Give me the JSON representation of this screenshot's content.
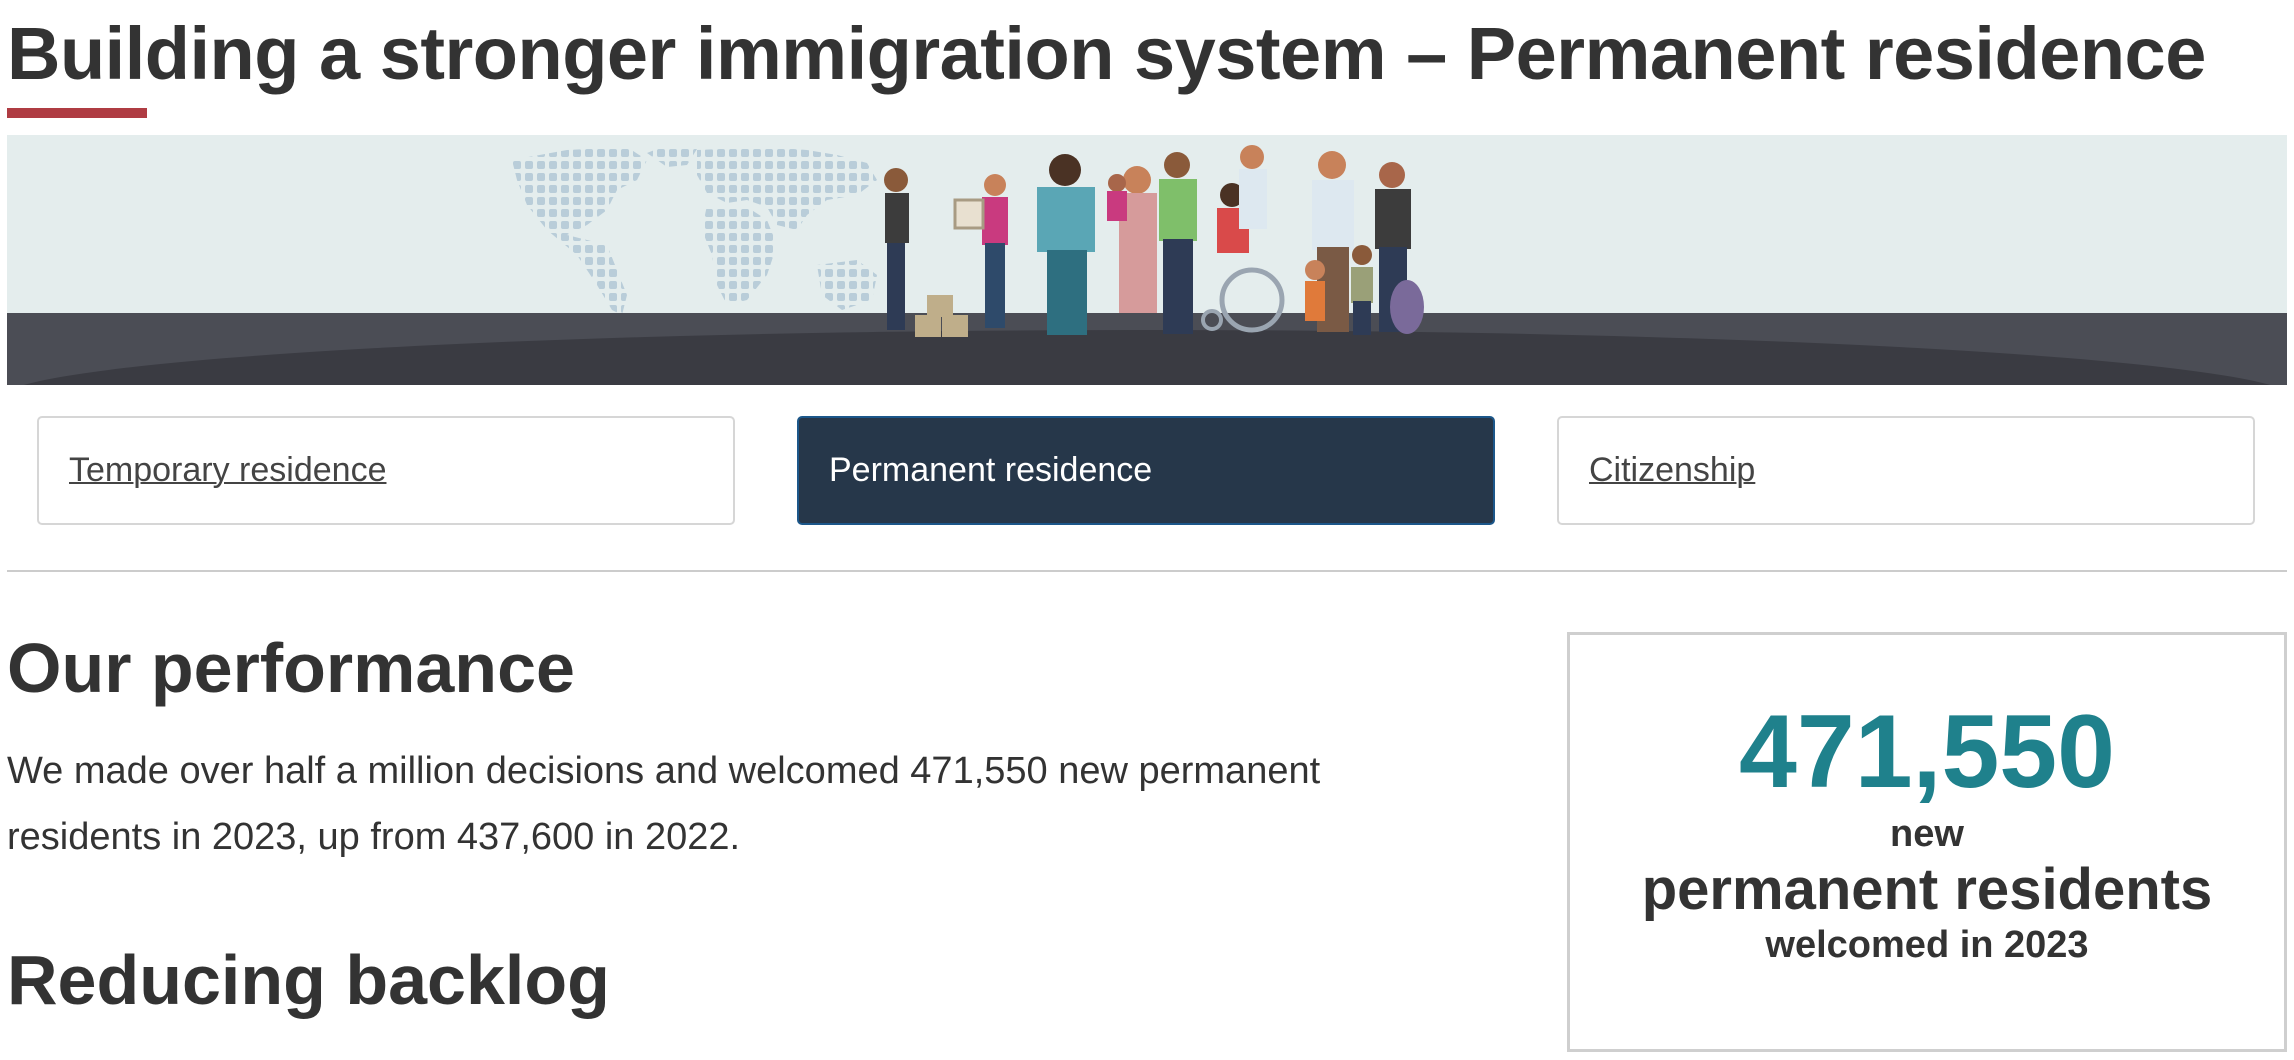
{
  "page": {
    "title": "Building a stronger immigration system – Permanent residence"
  },
  "colors": {
    "accent_underline": "#af3c43",
    "active_tab_bg": "#26374a",
    "stat_number": "#1f818c",
    "text": "#333333"
  },
  "banner": {
    "icon": "people-illustration"
  },
  "tabs": [
    {
      "label": "Temporary residence",
      "active": false
    },
    {
      "label": "Permanent residence",
      "active": true
    },
    {
      "label": "Citizenship",
      "active": false
    }
  ],
  "performance": {
    "heading": "Our performance",
    "body": "We made over half a million decisions and welcomed 471,550 new permanent residents in 2023, up from 437,600 in 2022."
  },
  "stat_card": {
    "number": "471,550",
    "line1": "new",
    "line2": "permanent residents",
    "line3": "welcomed in 2023"
  },
  "backlog": {
    "heading": "Reducing backlog"
  }
}
